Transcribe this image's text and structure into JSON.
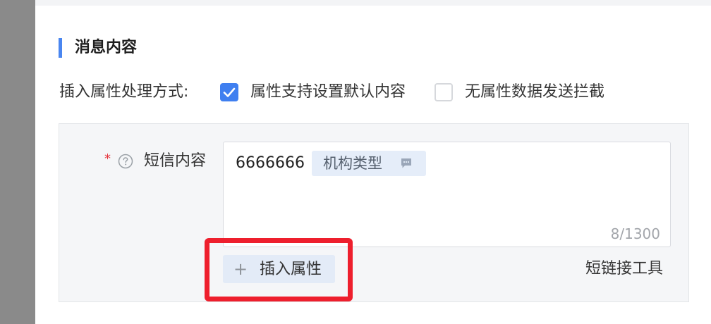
{
  "section": {
    "title": "消息内容"
  },
  "attr_handling": {
    "label": "插入属性处理方式:",
    "options": [
      {
        "label": "属性支持设置默认内容",
        "checked": true
      },
      {
        "label": "无属性数据发送拦截",
        "checked": false
      }
    ]
  },
  "sms": {
    "required_mark": "*",
    "label": "短信内容",
    "content_text": "6666666",
    "attribute_tag": "机构类型",
    "char_counter": "8/1300",
    "insert_attribute_button": "插入属性",
    "short_link_tool": "短链接工具"
  },
  "colors": {
    "accent": "#3f7ff0",
    "highlight": "#ee1f2d",
    "panel_bg": "#f5f6f8",
    "tag_bg": "#e5edf9"
  },
  "icons": {
    "help": "question-circle-icon",
    "tag": "comment-dots-icon",
    "plus": "plus-icon",
    "check": "check-icon"
  }
}
